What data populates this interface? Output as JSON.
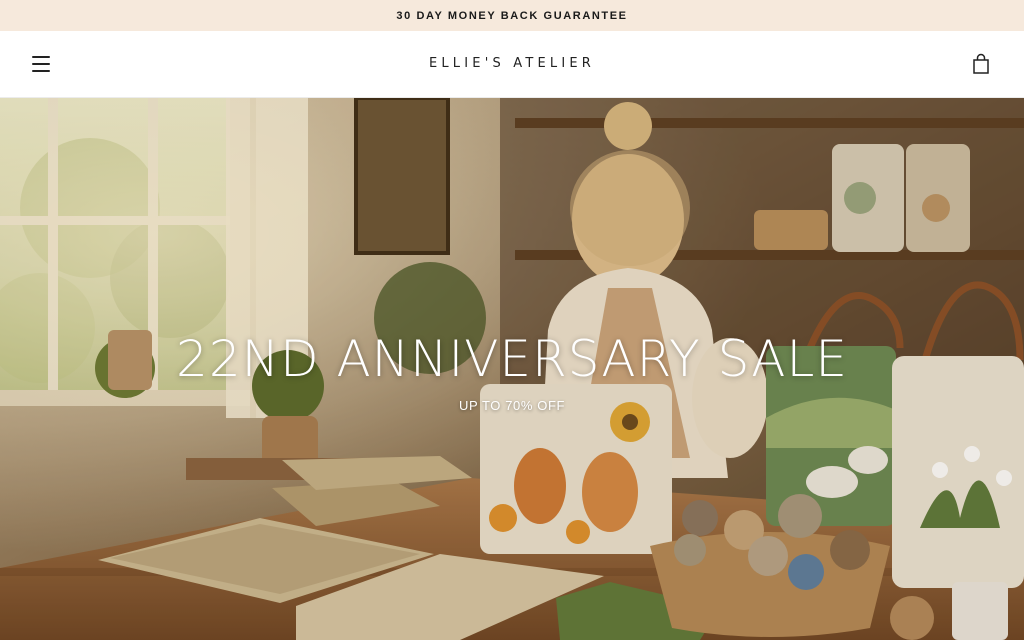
{
  "announcement": {
    "text": "30 DAY MONEY BACK GUARANTEE"
  },
  "header": {
    "menu_icon": "hamburger-menu-icon",
    "brand": "ELLIE'S ATELIER",
    "cart_icon": "shopping-bag-icon"
  },
  "hero": {
    "title": "22ND ANNIVERSARY SALE",
    "subtitle": "UP TO 70% OFF"
  },
  "colors": {
    "announcement_bg": "#f6e9dc",
    "header_bg": "#ffffff",
    "hero_text": "#ffffff",
    "text_dark": "#1a1a1a"
  }
}
